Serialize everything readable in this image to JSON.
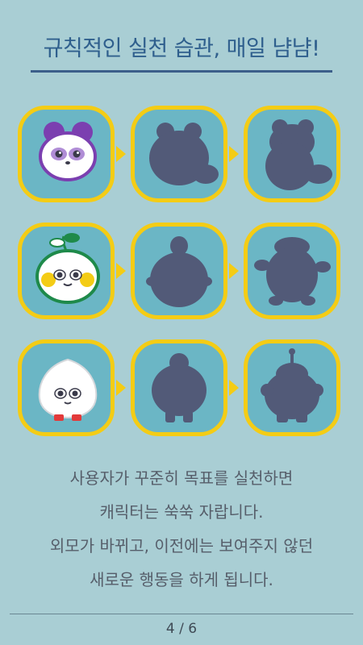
{
  "header": {
    "title": "규칙적인 실천 습관, 매일 냠냠!"
  },
  "characters": [
    {
      "name": "raccoon",
      "stages": [
        "raccoon-baby-icon",
        "raccoon-silhouette-stage-2-icon",
        "raccoon-silhouette-stage-3-icon"
      ]
    },
    {
      "name": "sprout",
      "stages": [
        "sprout-baby-icon",
        "sprout-silhouette-stage-2-icon",
        "sprout-silhouette-stage-3-icon"
      ]
    },
    {
      "name": "dumpling",
      "stages": [
        "dumpling-baby-icon",
        "dumpling-silhouette-stage-2-icon",
        "dumpling-silhouette-stage-3-icon"
      ]
    }
  ],
  "colors": {
    "background": "#a9ced4",
    "tile_fill": "#6bb6c5",
    "tile_border": "#f4cc15",
    "silhouette": "#525a78",
    "title": "#2f5f8d"
  },
  "description": {
    "line1": "사용자가 꾸준히 목표를 실천하면",
    "line2": "캐릭터는 쑥쑥 자랍니다.",
    "line3": "외모가 바뀌고, 이전에는 보여주지 않던",
    "line4": "새로운 행동을 하게 됩니다."
  },
  "pager": {
    "label": "4 / 6"
  }
}
